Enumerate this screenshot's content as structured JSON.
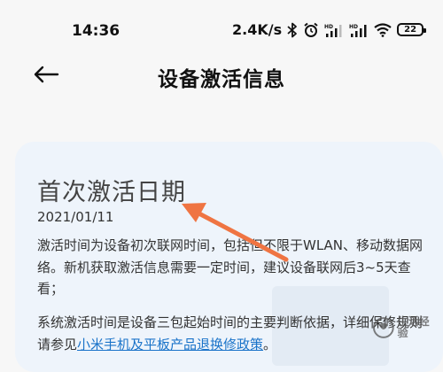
{
  "status_bar": {
    "time": "14:36",
    "net_speed": "2.4K/s",
    "battery": "22"
  },
  "header": {
    "title": "设备激活信息"
  },
  "card": {
    "title": "首次激活日期",
    "date": "2021/01/11",
    "paragraph1": "激活时间为设备初次联网时间，包括但不限于WLAN、移动数据网络。新机获取激活信息需要一定时间，建议设备联网后3~5天查看；",
    "paragraph2_prefix": "系统激活时间是设备三包起始时间的主要判断依据，详细保修规则请参见",
    "paragraph2_link": "小米手机及平板产品退换修政策",
    "paragraph2_suffix": "。"
  },
  "watermark": {
    "text": "生活经验"
  },
  "colors": {
    "card_bg": "#eef4fb",
    "link": "#1a73c9",
    "arrow": "#ef7442"
  }
}
